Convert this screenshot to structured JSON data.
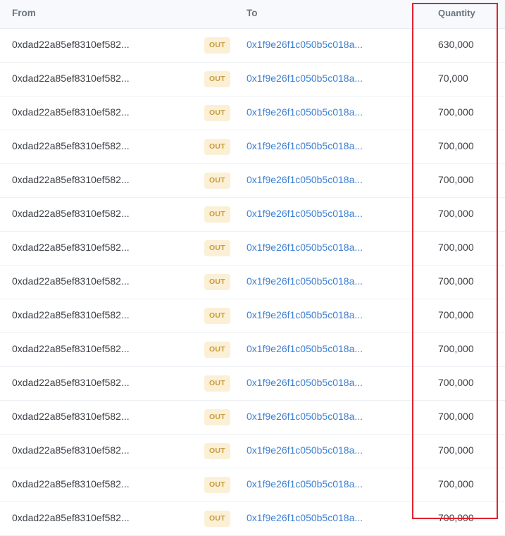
{
  "headers": {
    "from": "From",
    "to": "To",
    "quantity": "Quantity"
  },
  "rows": [
    {
      "from": "0xdad22a85ef8310ef582...",
      "direction": "OUT",
      "to": "0x1f9e26f1c050b5c018a...",
      "quantity": "630,000"
    },
    {
      "from": "0xdad22a85ef8310ef582...",
      "direction": "OUT",
      "to": "0x1f9e26f1c050b5c018a...",
      "quantity": "70,000"
    },
    {
      "from": "0xdad22a85ef8310ef582...",
      "direction": "OUT",
      "to": "0x1f9e26f1c050b5c018a...",
      "quantity": "700,000"
    },
    {
      "from": "0xdad22a85ef8310ef582...",
      "direction": "OUT",
      "to": "0x1f9e26f1c050b5c018a...",
      "quantity": "700,000"
    },
    {
      "from": "0xdad22a85ef8310ef582...",
      "direction": "OUT",
      "to": "0x1f9e26f1c050b5c018a...",
      "quantity": "700,000"
    },
    {
      "from": "0xdad22a85ef8310ef582...",
      "direction": "OUT",
      "to": "0x1f9e26f1c050b5c018a...",
      "quantity": "700,000"
    },
    {
      "from": "0xdad22a85ef8310ef582...",
      "direction": "OUT",
      "to": "0x1f9e26f1c050b5c018a...",
      "quantity": "700,000"
    },
    {
      "from": "0xdad22a85ef8310ef582...",
      "direction": "OUT",
      "to": "0x1f9e26f1c050b5c018a...",
      "quantity": "700,000"
    },
    {
      "from": "0xdad22a85ef8310ef582...",
      "direction": "OUT",
      "to": "0x1f9e26f1c050b5c018a...",
      "quantity": "700,000"
    },
    {
      "from": "0xdad22a85ef8310ef582...",
      "direction": "OUT",
      "to": "0x1f9e26f1c050b5c018a...",
      "quantity": "700,000"
    },
    {
      "from": "0xdad22a85ef8310ef582...",
      "direction": "OUT",
      "to": "0x1f9e26f1c050b5c018a...",
      "quantity": "700,000"
    },
    {
      "from": "0xdad22a85ef8310ef582...",
      "direction": "OUT",
      "to": "0x1f9e26f1c050b5c018a...",
      "quantity": "700,000"
    },
    {
      "from": "0xdad22a85ef8310ef582...",
      "direction": "OUT",
      "to": "0x1f9e26f1c050b5c018a...",
      "quantity": "700,000"
    },
    {
      "from": "0xdad22a85ef8310ef582...",
      "direction": "OUT",
      "to": "0x1f9e26f1c050b5c018a...",
      "quantity": "700,000"
    },
    {
      "from": "0xdad22a85ef8310ef582...",
      "direction": "OUT",
      "to": "0x1f9e26f1c050b5c018a...",
      "quantity": "700,000"
    }
  ],
  "colors": {
    "link": "#3d7fd1",
    "badge_text": "#c89a3b",
    "badge_bg": "#fbf0d6",
    "highlight": "#e0242e"
  }
}
